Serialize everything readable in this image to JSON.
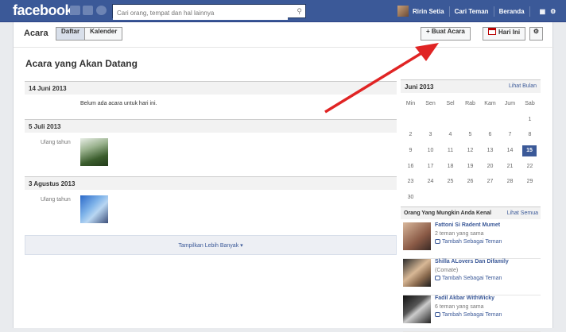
{
  "topbar": {
    "logo": "facebook",
    "search_placeholder": "Cari orang, tempat dan hal lainnya",
    "user_name": "Ririn Setia",
    "find_friends": "Cari Teman",
    "home": "Beranda"
  },
  "subheader": {
    "title": "Acara",
    "tab_list": "Daftar",
    "tab_calendar": "Kalender",
    "create_event": "+ Buat Acara",
    "today": "Hari Ini"
  },
  "events": {
    "heading": "Acara yang Akan Datang",
    "groups": [
      {
        "date": "14 Juni 2013",
        "text": "Belum ada acara untuk hari ini."
      },
      {
        "date": "5 Juli 2013",
        "label": "Ulang tahun"
      },
      {
        "date": "3 Agustus 2013",
        "label": "Ulang tahun"
      }
    ],
    "show_more": "Tampilkan Lebih Banyak"
  },
  "calendar": {
    "month": "Juni 2013",
    "view_month": "Lihat Bulan",
    "days": [
      "Min",
      "Sen",
      "Sel",
      "Rab",
      "Kam",
      "Jum",
      "Sab"
    ],
    "weeks": [
      [
        "",
        "",
        "",
        "",
        "",
        "",
        "1"
      ],
      [
        "2",
        "3",
        "4",
        "5",
        "6",
        "7",
        "8"
      ],
      [
        "9",
        "10",
        "11",
        "12",
        "13",
        "14",
        "15"
      ],
      [
        "16",
        "17",
        "18",
        "19",
        "20",
        "21",
        "22"
      ],
      [
        "23",
        "24",
        "25",
        "26",
        "27",
        "28",
        "29"
      ],
      [
        "30",
        "",
        "",
        "",
        "",
        "",
        ""
      ]
    ],
    "today": "15"
  },
  "people": {
    "heading": "Orang Yang Mungkin Anda Kenal",
    "see_all": "Lihat Semua",
    "add_label": "Tambah Sebagai Teman",
    "list": [
      {
        "name": "Fattoni Si Radent Mumet",
        "meta": "2 teman yang sama"
      },
      {
        "name": "Shilla ALovers Dan Difamily",
        "meta": "(Comate)"
      },
      {
        "name": "Fadil Akbar WithWicky",
        "meta": "6 teman yang sama"
      }
    ]
  },
  "colors": {
    "brand": "#3b5998",
    "annotation_arrow": "#e02424"
  }
}
